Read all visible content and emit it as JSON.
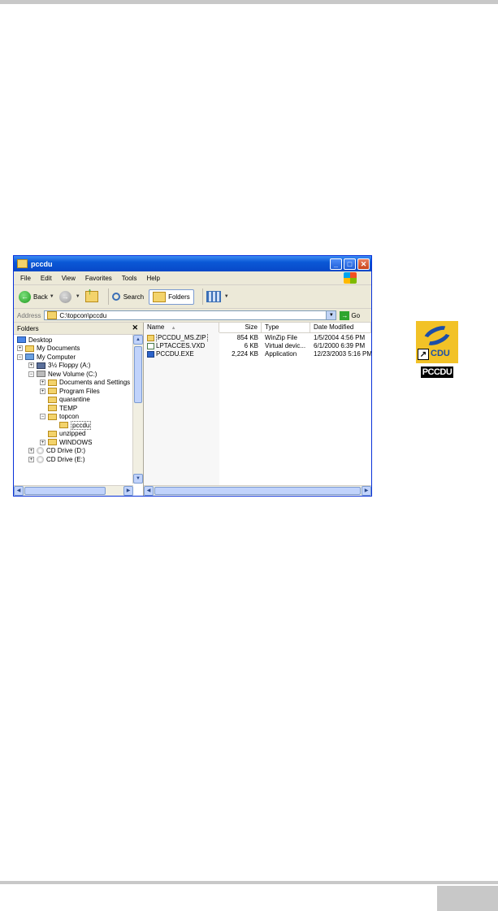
{
  "window": {
    "title": "pccdu",
    "menu": [
      "File",
      "Edit",
      "View",
      "Favorites",
      "Tools",
      "Help"
    ],
    "toolbar": {
      "back": "Back",
      "search": "Search",
      "folders": "Folders"
    },
    "address": {
      "label": "Address",
      "value": "C:\\topcon\\pccdu",
      "go": "Go"
    },
    "folders_pane": {
      "title": "Folders",
      "tree": [
        {
          "label": "Desktop",
          "expander": "",
          "icon": "desktop"
        },
        {
          "label": "My Documents",
          "expander": "+",
          "icon": "docs"
        },
        {
          "label": "My Computer",
          "expander": "−",
          "icon": "computer"
        },
        {
          "label": "3½ Floppy (A:)",
          "expander": "+",
          "icon": "floppy"
        },
        {
          "label": "New Volume (C:)",
          "expander": "−",
          "icon": "drive"
        },
        {
          "label": "Documents and Settings",
          "expander": "+",
          "icon": "folder"
        },
        {
          "label": "Program Files",
          "expander": "+",
          "icon": "folder"
        },
        {
          "label": "quarantine",
          "expander": "",
          "icon": "folder"
        },
        {
          "label": "TEMP",
          "expander": "",
          "icon": "folder"
        },
        {
          "label": "topcon",
          "expander": "−",
          "icon": "folder"
        },
        {
          "label": "pccdu",
          "expander": "",
          "icon": "folder"
        },
        {
          "label": "unzipped",
          "expander": "",
          "icon": "folder"
        },
        {
          "label": "WINDOWS",
          "expander": "+",
          "icon": "folder"
        },
        {
          "label": "CD Drive (D:)",
          "expander": "+",
          "icon": "cd"
        },
        {
          "label": "CD Drive (E:)",
          "expander": "+",
          "icon": "cd"
        }
      ]
    },
    "file_list": {
      "columns": [
        "Name",
        "Size",
        "Type",
        "Date Modified"
      ],
      "sort_indicator": "▲",
      "rows": [
        {
          "name": "PCCDU_MS.ZIP",
          "size": "854 KB",
          "type": "WinZip File",
          "date": "1/5/2004 4:56 PM",
          "icon": "zip"
        },
        {
          "name": "LPTACCES.VXD",
          "size": "6 KB",
          "type": "Virtual devic...",
          "date": "6/1/2000 6:39 PM",
          "icon": "vxd"
        },
        {
          "name": "PCCDU.EXE",
          "size": "2,224 KB",
          "type": "Application",
          "date": "12/23/2003 5:16 PM",
          "icon": "exe"
        }
      ]
    }
  },
  "shortcut": {
    "icon_text": "CDU",
    "label": "PCCDU"
  }
}
